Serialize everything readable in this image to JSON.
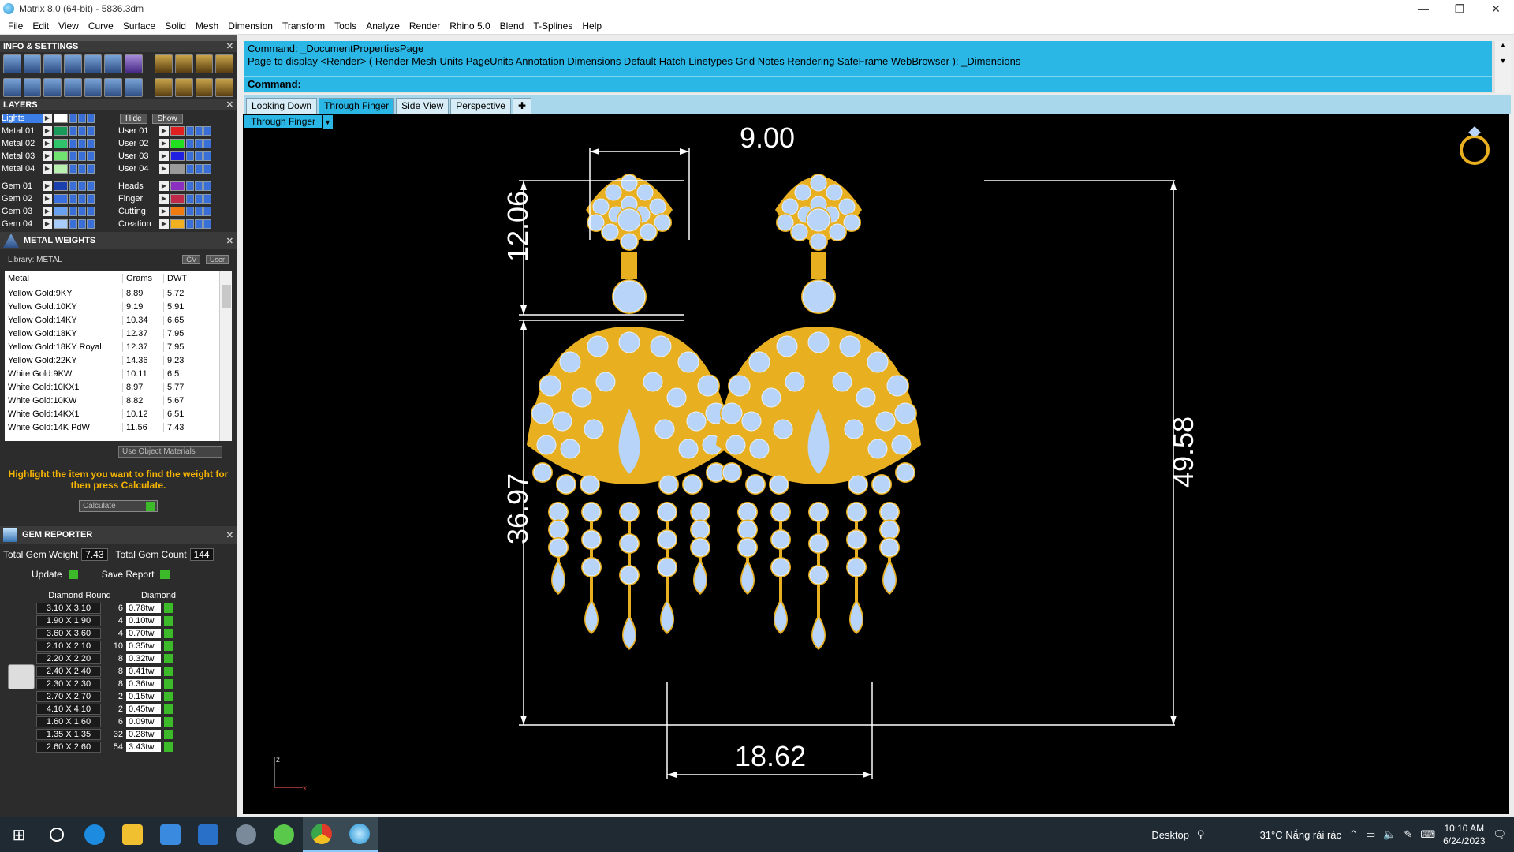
{
  "window": {
    "title": "Matrix 8.0 (64-bit) - 5836.3dm"
  },
  "menu": [
    "File",
    "Edit",
    "View",
    "Curve",
    "Surface",
    "Solid",
    "Mesh",
    "Dimension",
    "Transform",
    "Tools",
    "Analyze",
    "Render",
    "Rhino 5.0",
    "Blend",
    "T-Splines",
    "Help"
  ],
  "info_settings": {
    "title": "INFO & SETTINGS"
  },
  "layers": {
    "title": "LAYERS",
    "hide": "Hide",
    "show": "Show",
    "lights": "Lights",
    "left": [
      {
        "name": "Metal 01",
        "color": "#1a9a5a"
      },
      {
        "name": "Metal 02",
        "color": "#2fc46a"
      },
      {
        "name": "Metal 03",
        "color": "#6fe26f"
      },
      {
        "name": "Metal 04",
        "color": "#b8f0b0"
      },
      {
        "name": "Gem 01",
        "color": "#1c3fae"
      },
      {
        "name": "Gem 02",
        "color": "#3a6fe0"
      },
      {
        "name": "Gem 03",
        "color": "#6aa0f0"
      },
      {
        "name": "Gem 04",
        "color": "#a8ccf8"
      }
    ],
    "right": [
      {
        "name": "User 01",
        "color": "#e02020"
      },
      {
        "name": "User 02",
        "color": "#20e020"
      },
      {
        "name": "User 03",
        "color": "#2020e0"
      },
      {
        "name": "User 04",
        "color": "#9a9a9a"
      },
      {
        "name": "Heads",
        "color": "#8a2fc0"
      },
      {
        "name": "Finger",
        "color": "#c02a4a"
      },
      {
        "name": "Cutting",
        "color": "#f07a10"
      },
      {
        "name": "Creation",
        "color": "#f0b020"
      }
    ]
  },
  "metal_weights": {
    "title": "METAL WEIGHTS",
    "library": "Library: METAL",
    "gv": "GV",
    "user": "User",
    "headers": [
      "Metal",
      "Grams",
      "DWT"
    ],
    "rows": [
      [
        "Yellow Gold:9KY",
        "8.89",
        "5.72"
      ],
      [
        "Yellow Gold:10KY",
        "9.19",
        "5.91"
      ],
      [
        "Yellow Gold:14KY",
        "10.34",
        "6.65"
      ],
      [
        "Yellow Gold:18KY",
        "12.37",
        "7.95"
      ],
      [
        "Yellow Gold:18KY Royal",
        "12.37",
        "7.95"
      ],
      [
        "Yellow Gold:22KY",
        "14.36",
        "9.23"
      ],
      [
        "White Gold:9KW",
        "10.11",
        "6.5"
      ],
      [
        "White Gold:10KX1",
        "8.97",
        "5.77"
      ],
      [
        "White Gold:10KW",
        "8.82",
        "5.67"
      ],
      [
        "White Gold:14KX1",
        "10.12",
        "6.51"
      ],
      [
        "White Gold:14K PdW",
        "11.56",
        "7.43"
      ]
    ],
    "use_object_materials": "Use Object Materials",
    "hint": "Highlight the item you want to find the weight for then press Calculate.",
    "calculate": "Calculate"
  },
  "gem_reporter": {
    "title": "GEM REPORTER",
    "total_weight_label": "Total Gem Weight",
    "total_weight": "7.43",
    "total_count_label": "Total Gem Count",
    "total_count": "144",
    "update": "Update",
    "save_report": "Save Report",
    "col_shape": "Diamond Round",
    "col_type": "Diamond",
    "rows": [
      [
        "3.10 X 3.10",
        "6",
        "0.78tw"
      ],
      [
        "1.90 X 1.90",
        "4",
        "0.10tw"
      ],
      [
        "3.60 X 3.60",
        "4",
        "0.70tw"
      ],
      [
        "2.10 X 2.10",
        "10",
        "0.35tw"
      ],
      [
        "2.20 X 2.20",
        "8",
        "0.32tw"
      ],
      [
        "2.40 X 2.40",
        "8",
        "0.41tw"
      ],
      [
        "2.30 X 2.30",
        "8",
        "0.36tw"
      ],
      [
        "2.70 X 2.70",
        "2",
        "0.15tw"
      ],
      [
        "4.10 X 4.10",
        "2",
        "0.45tw"
      ],
      [
        "1.60 X 1.60",
        "6",
        "0.09tw"
      ],
      [
        "1.35 X 1.35",
        "32",
        "0.28tw"
      ],
      [
        "2.60 X 2.60",
        "54",
        "3.43tw"
      ]
    ]
  },
  "command": {
    "line1": "Command: _DocumentPropertiesPage",
    "line2": "Page to display <Render> ( Render  Mesh  Units  PageUnits  Annotation  Dimensions  Default  Hatch  Linetypes  Grid  Notes  Rendering  SafeFrame  WebBrowser ): _Dimensions",
    "prompt": "Command:"
  },
  "tabs": [
    "Looking Down",
    "Through Finger",
    "Side View",
    "Perspective"
  ],
  "active_tab": "Through Finger",
  "viewport": {
    "label": "Through Finger",
    "dims": {
      "top_width": "9.00",
      "head_height": "12.06",
      "body_height": "36.97",
      "total_height": "49.58",
      "bottom_width": "18.62"
    },
    "axis_z": "z",
    "axis_x": "x"
  },
  "taskbar": {
    "desktop": "Desktop",
    "weather": "31°C  Nắng rải rác",
    "time": "10:10 AM",
    "date": "6/24/2023"
  },
  "colors": {
    "accent": "#2bb7e6",
    "gold": "#e8b020",
    "gem": "#b8d4f8",
    "hint": "#f5b400"
  }
}
